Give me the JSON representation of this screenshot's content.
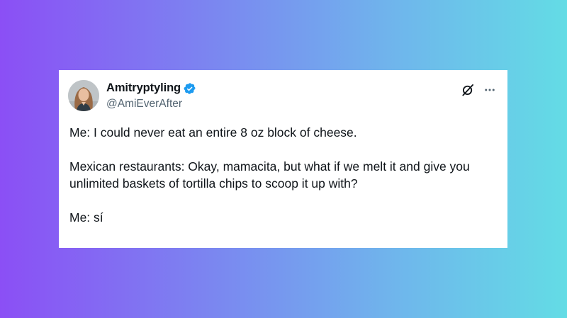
{
  "tweet": {
    "display_name": "Amitryptyling",
    "handle": "@AmiEverAfter",
    "verified": true,
    "icons": {
      "verified": "verified-badge-icon",
      "grok": "grok-icon",
      "more": "more-options-icon",
      "avatar": "profile-avatar"
    },
    "body": {
      "line1": "Me: I could never eat an entire 8 oz block of cheese.",
      "line2": "Mexican restaurants: Okay, mamacita, but what if we melt it and give you unlimited baskets of tortilla chips to scoop it up with?",
      "line3": "Me: sí"
    }
  },
  "colors": {
    "verified_blue": "#1d9bf0",
    "text_primary": "#0f1419",
    "text_secondary": "#536471"
  }
}
